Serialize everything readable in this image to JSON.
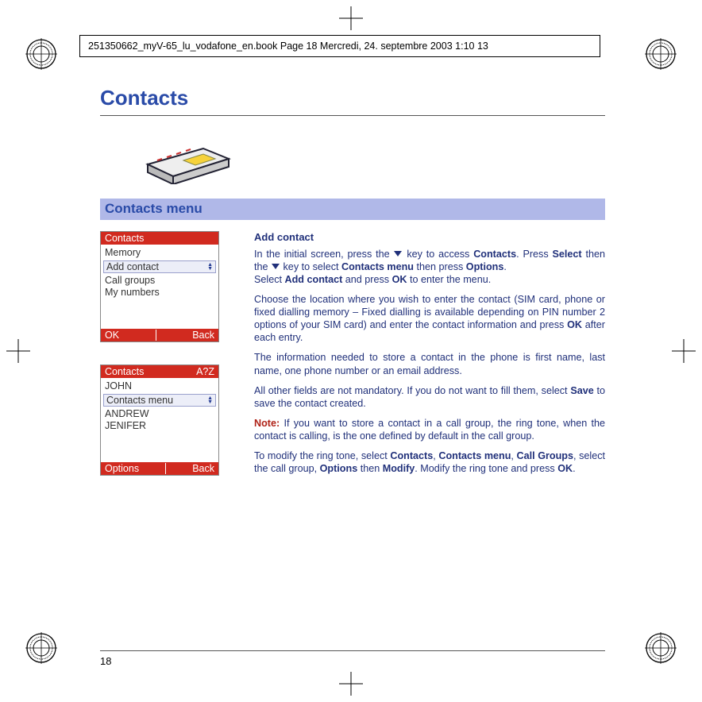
{
  "header_line": "251350662_myV-65_lu_vodafone_en.book  Page 18  Mercredi, 24. septembre 2003  1:10 13",
  "page_number": "18",
  "title": "Contacts",
  "section_heading": "Contacts menu",
  "phone1": {
    "header": "Contacts",
    "rows_before": [
      "Memory"
    ],
    "highlight": "Add contact",
    "rows_after": [
      "Call groups",
      "My numbers"
    ],
    "footer_left": "OK",
    "footer_right": "Back"
  },
  "phone2": {
    "header_left": "Contacts",
    "header_right": "A?Z",
    "rows_before": [
      "JOHN"
    ],
    "highlight": "Contacts menu",
    "rows_after": [
      "ANDREW",
      "JENIFER"
    ],
    "footer_left": "Options",
    "footer_right": "Back"
  },
  "body": {
    "subhead": "Add contact",
    "p1_a": "In the initial screen, press the ",
    "p1_b": " key to access ",
    "p1_c": "Contacts",
    "p1_d": ". Press ",
    "p1_e": "Select",
    "p1_f": " then the  ",
    "p1_g": " key to select ",
    "p1_h": "Contacts menu",
    "p1_i": " then press ",
    "p1_j": "Options",
    "p1_k": ".",
    "p1_l": "Select ",
    "p1_m": "Add contact",
    "p1_n": " and press ",
    "p1_o": "OK",
    "p1_p": " to enter the menu.",
    "p2_a": "Choose the location where you wish to enter the contact (SIM card, phone or fixed dialling memory – Fixed dialling is available depending on PIN number 2 options of your SIM card) and enter the contact information and  press ",
    "p2_b": "OK",
    "p2_c": " after each entry.",
    "p3": "The information needed to store a contact in the phone is first name, last name, one phone number or an email address.",
    "p4_a": "All other fields are not mandatory. If you do not want to fill them, select ",
    "p4_b": "Save",
    "p4_c": " to save the contact created.",
    "p5_label": "Note:",
    "p5": " If you want to store a contact in a call group, the ring tone, when the contact is calling, is the one defined by default in the call group.",
    "p6_a": "To modify the ring tone, select ",
    "p6_b": "Contacts",
    "p6_c": ", ",
    "p6_d": "Contacts menu",
    "p6_e": ", ",
    "p6_f": "Call Groups",
    "p6_g": ", select the call group, ",
    "p6_h": "Options",
    "p6_i": " then ",
    "p6_j": "Modify",
    "p6_k": ". Modify the ring tone and press ",
    "p6_l": "OK",
    "p6_m": "."
  }
}
